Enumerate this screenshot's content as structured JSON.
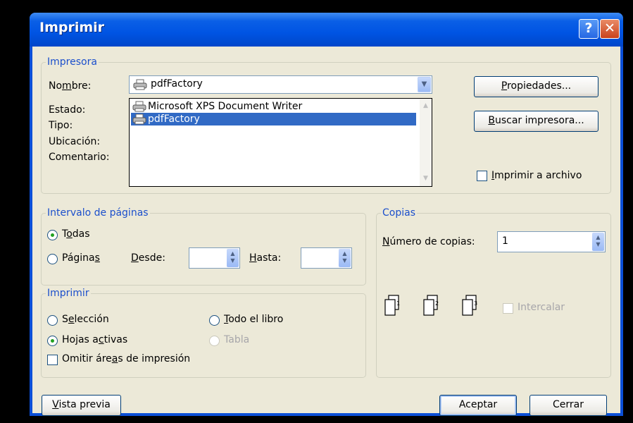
{
  "window": {
    "title": "Imprimir",
    "help_glyph": "?",
    "close_glyph": "✕"
  },
  "printer": {
    "group_label": "Impresora",
    "name_label": "Nombre:",
    "status_label": "Estado:",
    "type_label": "Tipo:",
    "location_label": "Ubicación:",
    "comment_label": "Comentario:",
    "selected": "pdfFactory",
    "options": [
      "Microsoft XPS Document Writer",
      "pdfFactory"
    ],
    "properties_button": "Propiedades...",
    "find_button": "Buscar impresora...",
    "print_to_file_label": "Imprimir a archivo"
  },
  "page_range": {
    "group_label": "Intervalo de páginas",
    "all_label": "Todas",
    "pages_label": "Páginas",
    "from_label": "Desde:",
    "to_label": "Hasta:",
    "selected": "Todas"
  },
  "print_what": {
    "group_label": "Imprimir",
    "selection_label": "Selección",
    "whole_book_label": "Todo el libro",
    "active_sheets_label": "Hojas activas",
    "table_label": "Tabla",
    "ignore_areas_label": "Omitir áreas de impresión",
    "selected": "Hojas activas"
  },
  "copies": {
    "group_label": "Copias",
    "count_label": "Número de copias:",
    "count_value": "1",
    "collate_label": "Intercalar",
    "collate_pages": [
      "1",
      "2",
      "3"
    ]
  },
  "footer": {
    "preview_button": "Vista previa",
    "ok_button": "Aceptar",
    "close_button": "Cerrar"
  }
}
